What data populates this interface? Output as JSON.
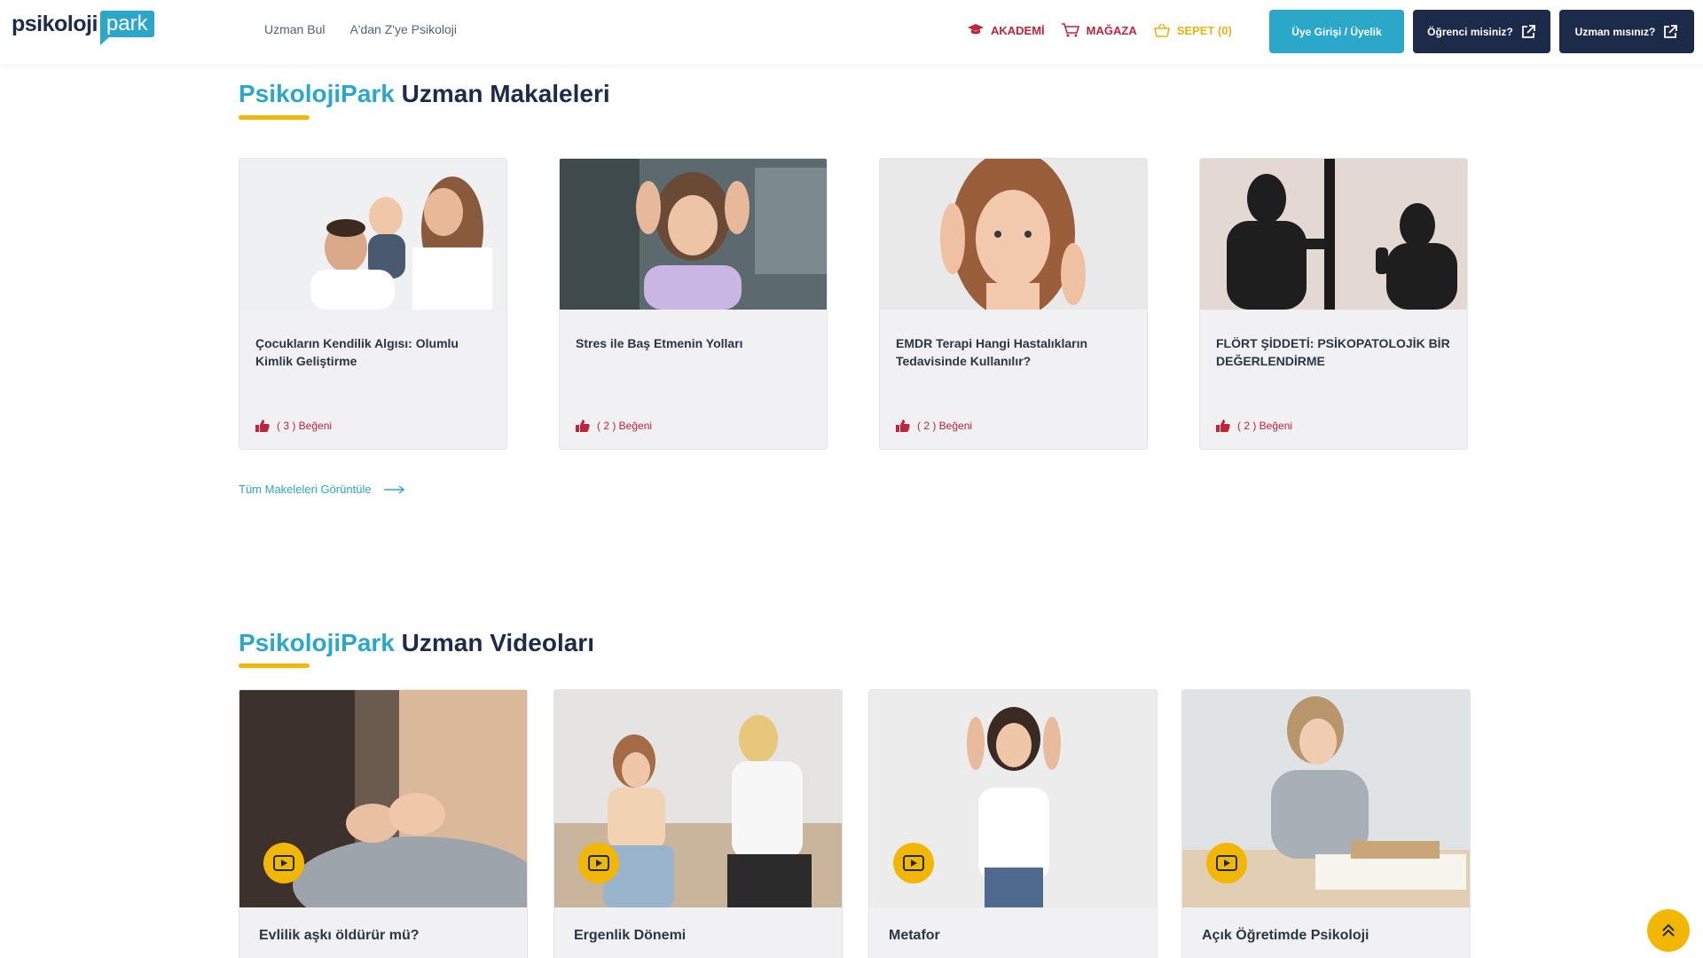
{
  "header": {
    "logo_left": "psikoloji",
    "logo_right": "park",
    "nav_left": [
      "Uzman Bul",
      "A'dan Z'ye Psikoloji"
    ],
    "akademi": "AKADEMİ",
    "magaza": "MAĞAZA",
    "sepet": "SEPET (0)",
    "login_button": "Üye Girişi / Üyelik",
    "student_button": "Öğrenci misiniz?",
    "expert_button": "Uzman mısınız?"
  },
  "articles": {
    "title_brand": "PsikolojiPark",
    "title_rest": "Uzman Makaleleri",
    "items": [
      {
        "title": "Çocukların Kendilik Algısı: Olumlu Kimlik Geliştirme",
        "likes": "( 3 ) Beğeni"
      },
      {
        "title": "Stres ile Baş Etmenin Yolları",
        "likes": "( 2 ) Beğeni"
      },
      {
        "title": "EMDR Terapi Hangi Hastalıkların Tedavisinde Kullanılır?",
        "likes": "( 2 ) Beğeni"
      },
      {
        "title": "FLÖRT ŞİDDETİ: PSİKOPATOLOJİK BİR DEĞERLENDİRME",
        "likes": "( 2 ) Beğeni"
      }
    ],
    "view_all": "Tüm Makeleleri Görüntüle"
  },
  "videos": {
    "title_brand": "PsikolojiPark",
    "title_rest": "Uzman Videoları",
    "items": [
      {
        "title": "Evlilik aşkı öldürür mü?"
      },
      {
        "title": "Ergenlik Dönemi"
      },
      {
        "title": "Metafor"
      },
      {
        "title": "Açık Öğretimde Psikoloji"
      }
    ]
  },
  "colors": {
    "brand_teal": "#2aa7c9",
    "navy": "#1c2b4a",
    "accent_yellow": "#f2b705",
    "accent_red": "#c0243a"
  }
}
